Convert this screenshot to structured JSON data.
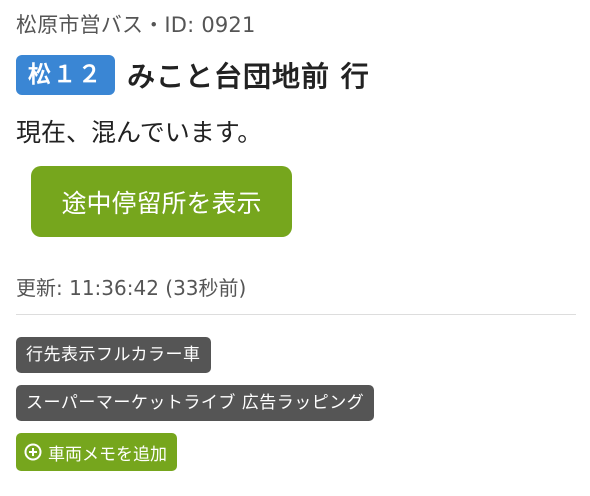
{
  "header": {
    "operator_line": "松原市営バス・ID: 0921"
  },
  "route": {
    "badge": "松１２",
    "destination": "みこと台団地前 行"
  },
  "status": {
    "text": "現在、混んでいます。"
  },
  "stops_button": {
    "label": "途中停留所を表示"
  },
  "updated": {
    "text": "更新: 11:36:42 (33秒前)"
  },
  "tags": [
    {
      "label": "行先表示フルカラー車"
    },
    {
      "label": "スーパーマーケットライブ 広告ラッピング"
    }
  ],
  "add_memo": {
    "label": "車両メモを追加",
    "icon": "plus-circle-icon"
  },
  "colors": {
    "route_badge": "#3a86d4",
    "primary_green": "#76a61d",
    "tag_gray": "#555555"
  }
}
